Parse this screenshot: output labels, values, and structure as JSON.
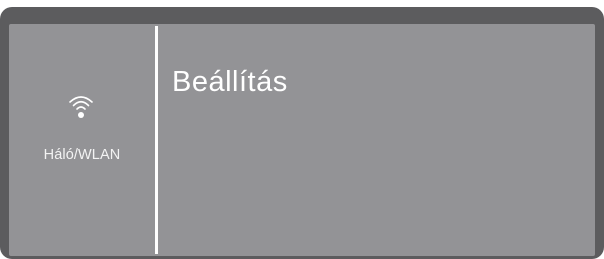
{
  "sidebar": {
    "items": [
      {
        "icon": "wifi-icon",
        "label": "Háló/WLAN"
      }
    ]
  },
  "main": {
    "title": "Beállítás"
  },
  "colors": {
    "bezel": "#5c5c5e",
    "screen": "#939396",
    "text": "#ffffff"
  }
}
